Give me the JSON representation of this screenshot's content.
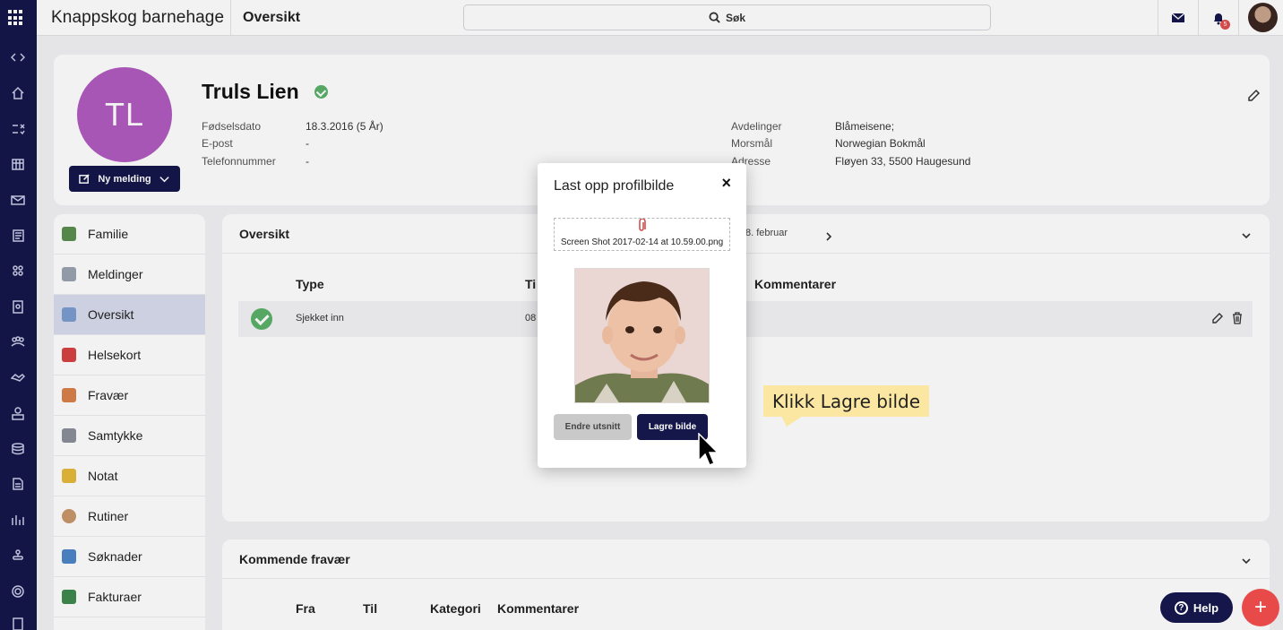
{
  "topbar": {
    "brand": "Knappskog barnehage",
    "page_title": "Oversikt",
    "search_label": "Søk",
    "notification_count": "5"
  },
  "rail": {
    "icons": [
      "collapse-icon",
      "home-icon",
      "tasks-icon",
      "calendar-icon",
      "mail-icon",
      "news-icon",
      "groups-icon",
      "badge-icon",
      "people-icon",
      "handshake-icon",
      "staff-icon",
      "billing-icon",
      "document-icon",
      "stats-icon",
      "org-icon",
      "settings-icon",
      "report-icon"
    ]
  },
  "profile": {
    "initials": "TL",
    "name": "Truls Lien",
    "new_message_label": "Ny melding",
    "fields_left": [
      {
        "label": "Fødselsdato",
        "value": "18.3.2016 (5 År)"
      },
      {
        "label": "E-post",
        "value": "-"
      },
      {
        "label": "Telefonnummer",
        "value": "-"
      }
    ],
    "fields_right": [
      {
        "label": "Avdelinger",
        "value": "Blåmeisene;"
      },
      {
        "label": "Morsmål",
        "value": "Norwegian Bokmål"
      },
      {
        "label": "Adresse",
        "value": "Fløyen 33, 5500 Haugesund"
      }
    ]
  },
  "menu": {
    "items": [
      {
        "label": "Familie",
        "color": "#5a8f4e"
      },
      {
        "label": "Meldinger",
        "color": "#9aa3b0"
      },
      {
        "label": "Oversikt",
        "color": "#7a9ccf"
      },
      {
        "label": "Helsekort",
        "color": "#d64242"
      },
      {
        "label": "Fravær",
        "color": "#d9814a"
      },
      {
        "label": "Samtykke",
        "color": "#8a8f9a"
      },
      {
        "label": "Notat",
        "color": "#e5b93c"
      },
      {
        "label": "Rutiner",
        "color": "#c9966a"
      },
      {
        "label": "Søknader",
        "color": "#4f86c9"
      },
      {
        "label": "Fakturaer",
        "color": "#3f8a4f"
      }
    ],
    "active_index": 2
  },
  "oversikt": {
    "title": "Oversikt",
    "date_label": "8. februar",
    "columns": {
      "type": "Type",
      "time": "Ti",
      "comments": "Kommentarer"
    },
    "rows": [
      {
        "type": "Sjekket inn",
        "time": "08"
      }
    ]
  },
  "kommende": {
    "title": "Kommende fravær",
    "columns": [
      "Fra",
      "Til",
      "Kategori",
      "Kommentarer"
    ]
  },
  "modal": {
    "title": "Last opp profilbilde",
    "close": "×",
    "file_name": "Screen Shot 2017-02-14 at 10.59.00.png",
    "crop_button": "Endre utsnitt",
    "save_button": "Lagre bilde"
  },
  "callout": {
    "text": "Klikk Lagre bilde"
  },
  "floating": {
    "help_label": "Help",
    "help_q": "?",
    "fab_label": "+"
  }
}
